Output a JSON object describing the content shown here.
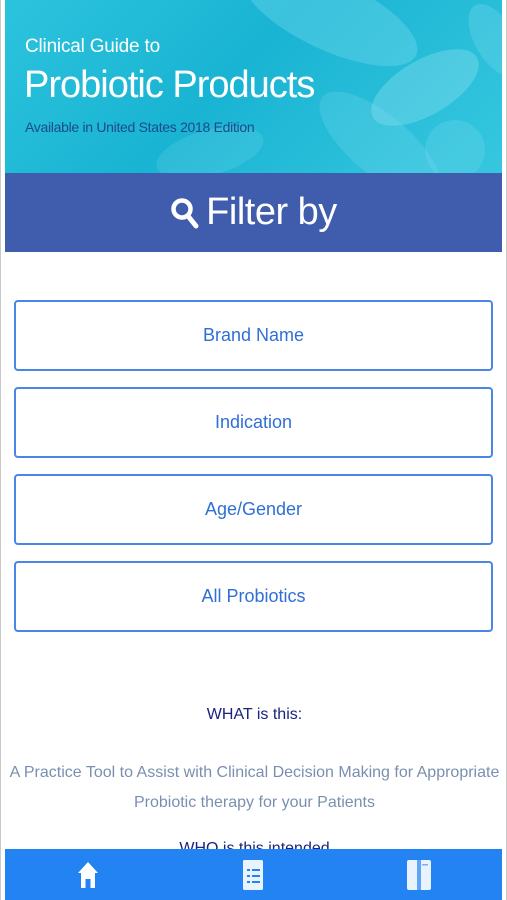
{
  "banner": {
    "line1": "Clinical Guide to",
    "line2": "Probiotic Products",
    "line3": "Available in United States 2018 Edition"
  },
  "filter": {
    "title": "Filter by",
    "icon": "search-icon"
  },
  "buttons": [
    {
      "label": "Brand Name"
    },
    {
      "label": "Indication"
    },
    {
      "label": "Age/Gender"
    },
    {
      "label": "All Probiotics"
    }
  ],
  "info": {
    "what_title": "WHAT is this:",
    "what_body": "A Practice Tool to Assist with Clinical Decision Making for Appropriate Probiotic therapy for your Patients",
    "who_title": "WHO is this intended"
  },
  "tabbar": {
    "tabs": [
      {
        "icon": "home-icon"
      },
      {
        "icon": "list-icon"
      },
      {
        "icon": "book-icon"
      }
    ]
  },
  "colors": {
    "banner": "#19b4d3",
    "filter_bar": "#3f5cad",
    "button_border": "#4a86e8",
    "button_text": "#2f6fd6",
    "tabbar": "#2483f3"
  }
}
